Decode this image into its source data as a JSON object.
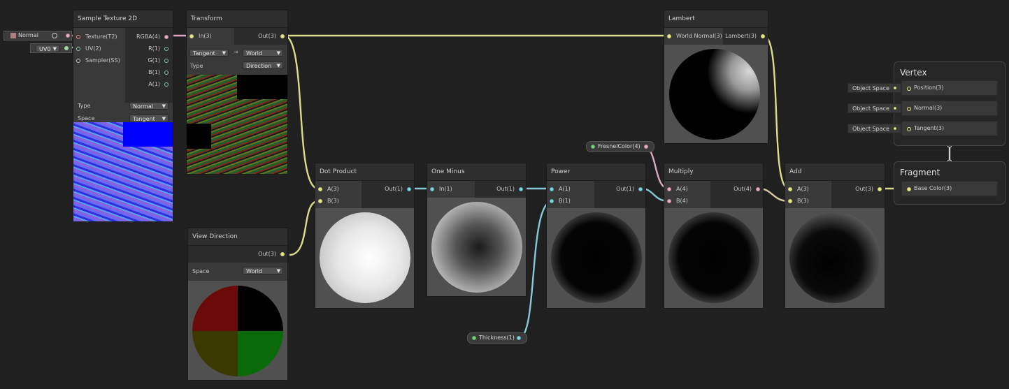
{
  "colors": {
    "background": "#202020",
    "wire_vector3": "#dadb8d",
    "wire_vector1": "#86c9d4",
    "wire_vector4": "#d9a9c3",
    "wire_texture": "#e68a8a",
    "wire_uv": "#a5d6a5"
  },
  "inline_inputs": {
    "normal_label": "Normal",
    "uv_label": "UV0"
  },
  "sample_texture": {
    "title": "Sample Texture 2D",
    "inputs": [
      "Texture(T2)",
      "UV(2)",
      "Sampler(SS)"
    ],
    "outputs": [
      "RGBA(4)",
      "R(1)",
      "G(1)",
      "B(1)",
      "A(1)"
    ],
    "type_label": "Type",
    "type_value": "Normal",
    "space_label": "Space",
    "space_value": "Tangent"
  },
  "transform": {
    "title": "Transform",
    "input": "In(3)",
    "output": "Out(3)",
    "from_value": "Tangent",
    "arrow": "→",
    "to_value": "World",
    "type_label": "Type",
    "type_value": "Direction"
  },
  "lambert": {
    "title": "Lambert",
    "input": "World Normal(3)",
    "output": "Lambert(3)"
  },
  "view_direction": {
    "title": "View Direction",
    "output": "Out(3)",
    "space_label": "Space",
    "space_value": "World"
  },
  "dot_product": {
    "title": "Dot Product",
    "inputs": [
      "A(3)",
      "B(3)"
    ],
    "output": "Out(1)"
  },
  "one_minus": {
    "title": "One Minus",
    "input": "In(1)",
    "output": "Out(1)"
  },
  "power": {
    "title": "Power",
    "inputs": [
      "A(1)",
      "B(1)"
    ],
    "output": "Out(1)"
  },
  "multiply": {
    "title": "Multiply",
    "inputs": [
      "A(4)",
      "B(4)"
    ],
    "output": "Out(4)"
  },
  "add": {
    "title": "Add",
    "inputs": [
      "A(3)",
      "B(3)"
    ],
    "output": "Out(3)"
  },
  "properties": {
    "fresnel": "FresnelColor(4)",
    "thickness": "Thickness(1)"
  },
  "vertex": {
    "title": "Vertex",
    "slots": [
      {
        "label": "Position(3)",
        "source": "Object Space"
      },
      {
        "label": "Normal(3)",
        "source": "Object Space"
      },
      {
        "label": "Tangent(3)",
        "source": "Object Space"
      }
    ]
  },
  "fragment": {
    "title": "Fragment",
    "slots": [
      {
        "label": "Base Color(3)"
      }
    ]
  }
}
